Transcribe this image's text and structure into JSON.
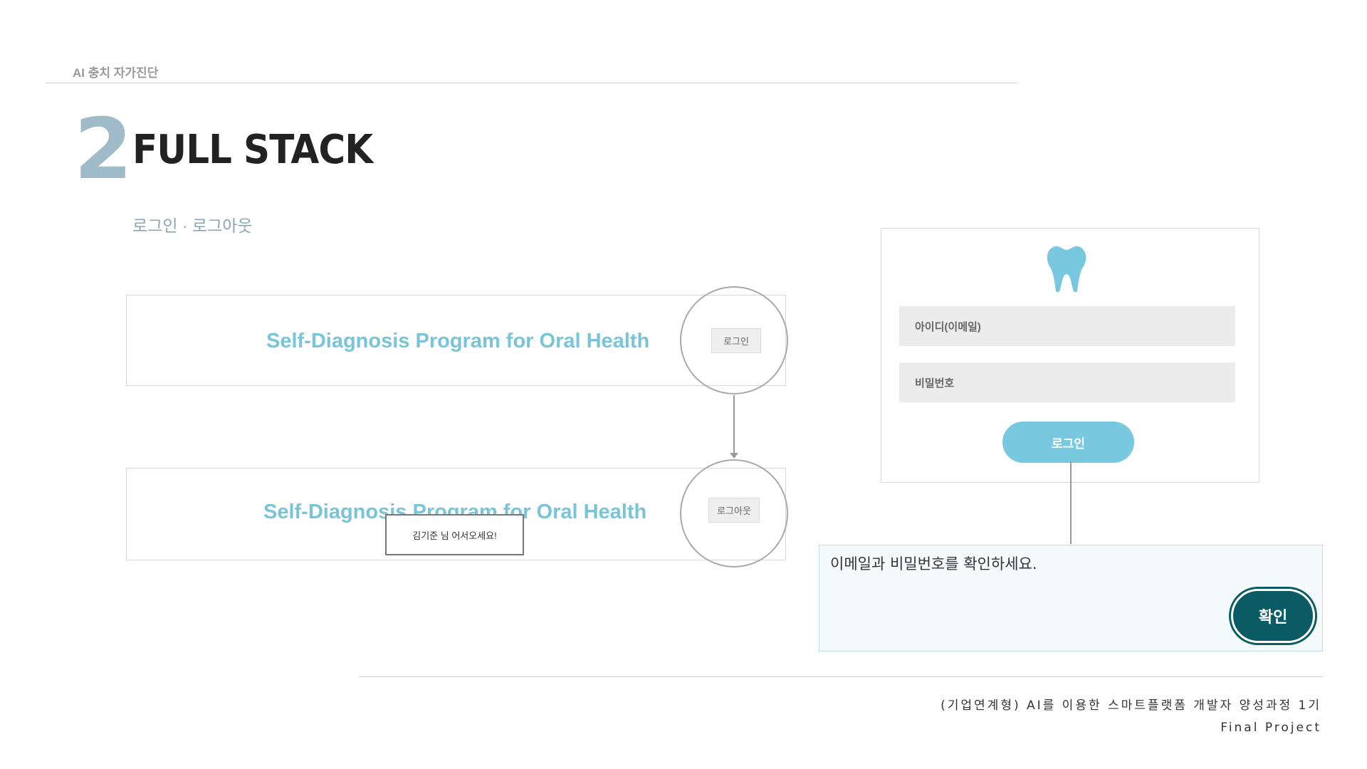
{
  "header": {
    "breadcrumb": "AI 충치 자가진단"
  },
  "section": {
    "number": "2",
    "title": "FULL STACK",
    "subtitle": "로그인 · 로그아웃"
  },
  "before_login_bar": {
    "site_title": "Self-Diagnosis Program for Oral Health",
    "button_label": "로그인"
  },
  "after_login_bar": {
    "site_title": "Self-Diagnosis Program for Oral Health",
    "button_label": "로그아웃",
    "welcome_text": "김기준 님 어서오세요!"
  },
  "login_form": {
    "logo_icon": "tooth-icon",
    "email_placeholder": "아이디(이메일)",
    "password_placeholder": "비밀번호",
    "submit_label": "로그인"
  },
  "alert": {
    "message": "이메일과 비밀번호를 확인하세요.",
    "confirm_label": "확인"
  },
  "footer": {
    "line1": "(기업연계형) AI를 이용한 스마트플랫폼 개발자 양성과정 1기",
    "line2": "Final Project"
  },
  "colors": {
    "accent": "#78c8df",
    "title_blue": "#78c4d8",
    "section_number": "#9fbac8",
    "confirm_button": "#0b5b64",
    "alert_background": "#f5fbfd"
  }
}
